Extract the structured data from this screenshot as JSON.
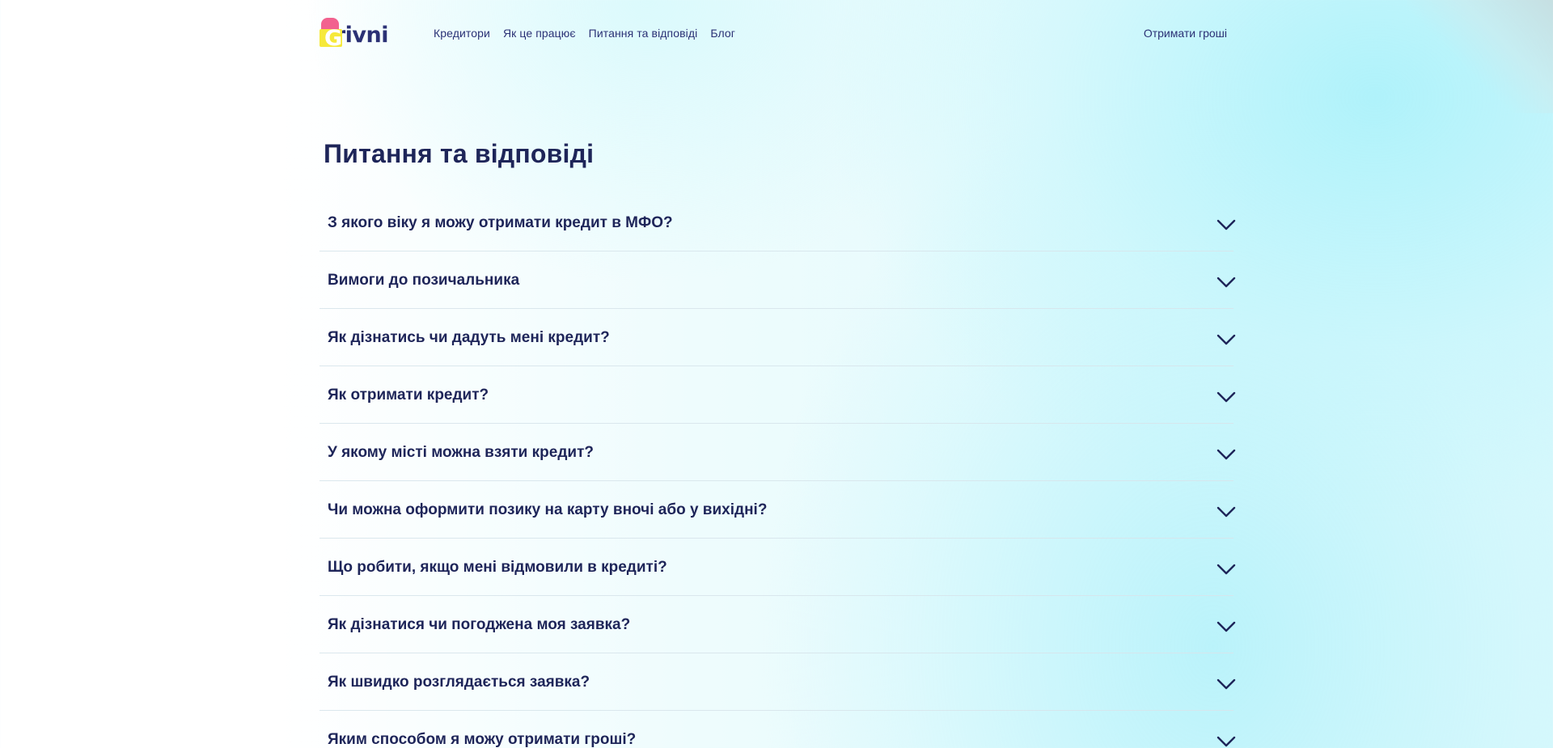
{
  "header": {
    "logo": {
      "letter": "G",
      "text": "rivni"
    },
    "nav": [
      {
        "label": "Кредитори"
      },
      {
        "label": "Як це працює"
      },
      {
        "label": "Питання та відповіді"
      },
      {
        "label": "Блог"
      }
    ],
    "cta_label": "Отримати гроші"
  },
  "main": {
    "title": "Питання та відповіді",
    "faq": [
      {
        "question": "З якого віку я можу отримати кредит в МФО?"
      },
      {
        "question": "Вимоги до позичальника"
      },
      {
        "question": "Як дізнатись чи дадуть мені кредит?"
      },
      {
        "question": "Як отримати кредит?"
      },
      {
        "question": "У якому місті можна взяти кредит?"
      },
      {
        "question": "Чи можна оформити позику на карту вночі або у вихідні?"
      },
      {
        "question": "Що робити, якщо мені відмовили в кредиті?"
      },
      {
        "question": "Як дізнатися чи погоджена моя заявка?"
      },
      {
        "question": "Як швидко розглядається заявка?"
      },
      {
        "question": "Яким способом я можу отримати гроші?"
      }
    ]
  },
  "icons": {
    "faq_toggle": "chevron-down-icon"
  },
  "colors": {
    "primary_text": "#1e2559",
    "logo_pink": "#f2628f",
    "logo_yellow": "#f6e93a",
    "background_accent": "#d9f8fc"
  }
}
